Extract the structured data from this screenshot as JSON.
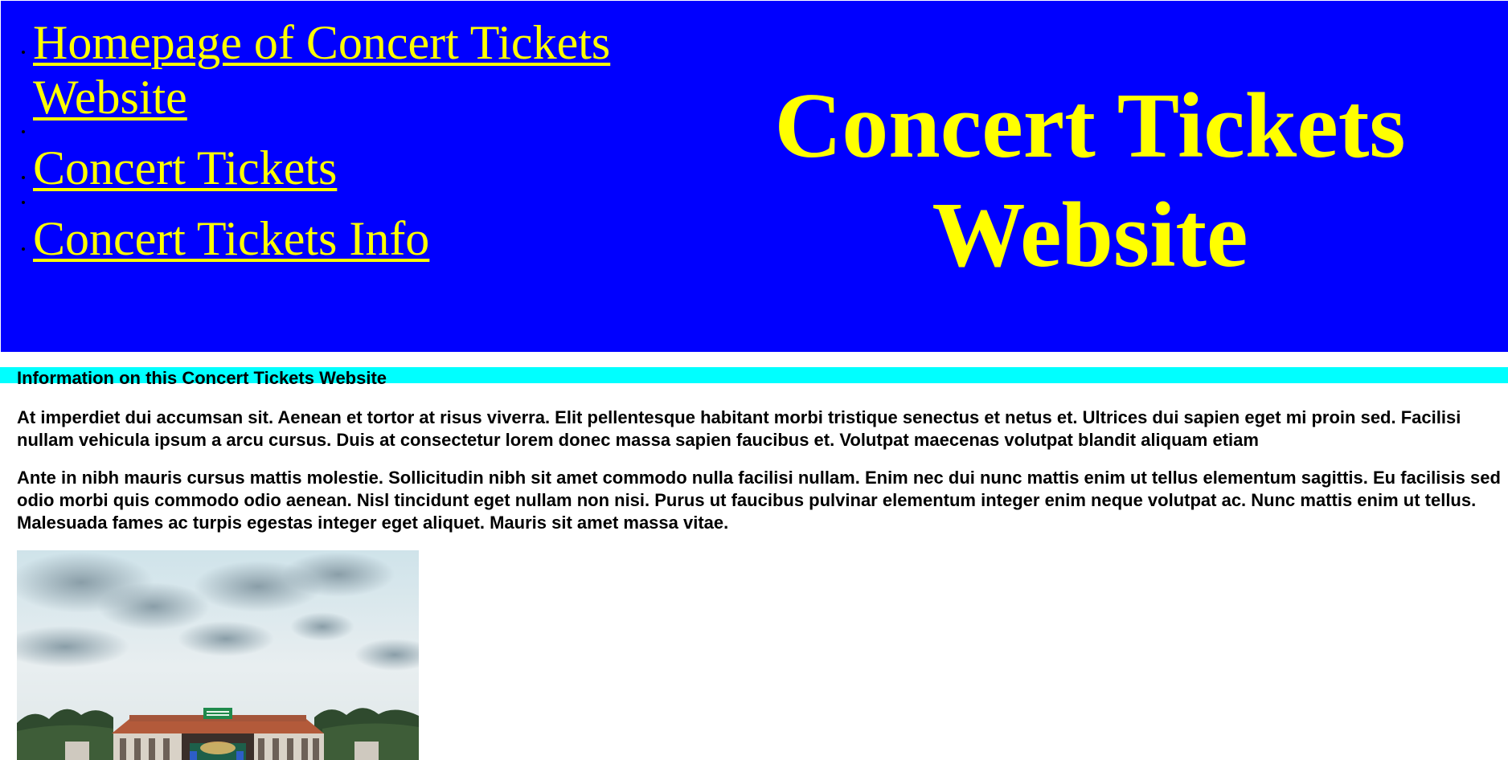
{
  "header": {
    "nav_items": [
      {
        "label": "Homepage of Concert Tickets Website"
      },
      {
        "label": "Concert Tickets"
      },
      {
        "label": "Concert Tickets Info"
      }
    ],
    "title": "Concert Tickets Website"
  },
  "content": {
    "heading": "Information on this Concert Tickets Website",
    "paragraphs": [
      "At imperdiet dui accumsan sit. Aenean et tortor at risus viverra. Elit pellentesque habitant morbi tristique senectus et netus et. Ultrices dui sapien eget mi proin sed. Facilisi nullam vehicula ipsum a arcu cursus. Duis at consectetur lorem donec massa sapien faucibus et. Volutpat maecenas volutpat blandit aliquam etiam",
      "Ante in nibh mauris cursus mattis molestie. Sollicitudin nibh sit amet commodo nulla facilisi nullam. Enim nec dui nunc mattis enim ut tellus elementum sagittis. Eu facilisis sed odio morbi quis commodo odio aenean. Nisl tincidunt eget nullam non nisi. Purus ut faucibus pulvinar elementum integer enim neque volutpat ac. Nunc mattis enim ut tellus. Malesuada fames ac turpis egestas integer eget aliquet. Mauris sit amet massa vitae."
    ]
  },
  "colors": {
    "header_bg": "#0000ff",
    "link_text": "#ffff00",
    "info_bar": "#00ffff",
    "body_text": "#000000"
  },
  "image": {
    "semantic": "outdoor-concert-venue-photo"
  }
}
